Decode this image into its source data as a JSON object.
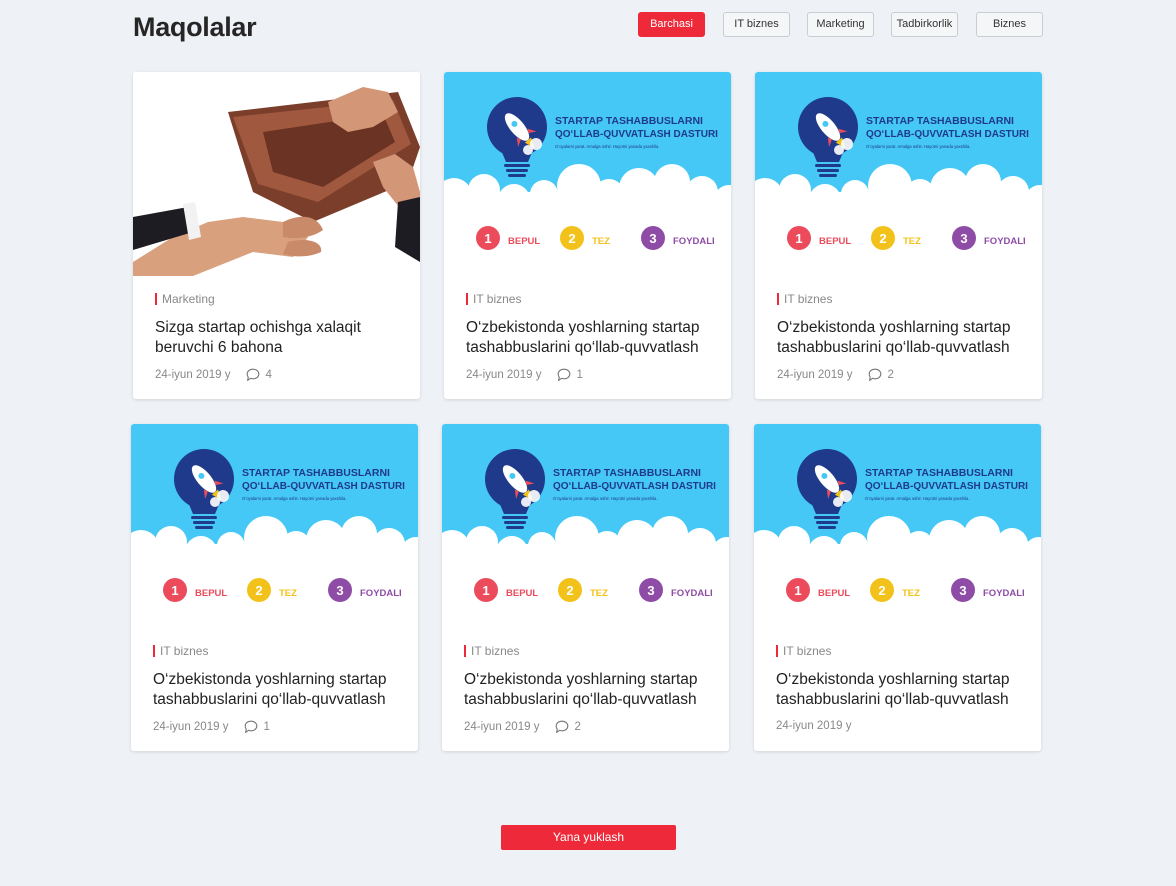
{
  "page": {
    "title": "Maqolalar"
  },
  "filters": [
    "Barchasi",
    "IT biznes",
    "Marketing",
    "Tadbirkorlik",
    "Biznes"
  ],
  "active_filter": "Barchasi",
  "banner": {
    "line1": "STARTAP  TASHABBUSLARNI",
    "line2": "QO‘LLAB-QUVVATLASH DASTURI",
    "tagline": "G‘oyalarni yarat. Amalga oshir. Hayotni yanada yaxshila.",
    "items": [
      {
        "num": "1",
        "label": "BEPUL"
      },
      {
        "num": "2",
        "label": "TEZ"
      },
      {
        "num": "3",
        "label": "FOYDALI"
      }
    ]
  },
  "articles": [
    {
      "image": "wallet-photo",
      "tag": "Marketing",
      "title": "Sizga startap ochishga xalaqit beruvchi 6 bahona",
      "date": "24-iyun 2019 y",
      "comments": "4"
    },
    {
      "image": "startup-banner",
      "tag": "IT biznes",
      "title": "O‘zbekistonda yoshlarning startap tashabbuslarini qo‘llab-quvvatlash",
      "date": "24-iyun 2019 y",
      "comments": "1"
    },
    {
      "image": "startup-banner",
      "tag": "IT biznes",
      "title": "O‘zbekistonda yoshlarning startap tashabbuslarini qo‘llab-quvvatlash",
      "date": "24-iyun 2019 y",
      "comments": "2"
    },
    {
      "image": "startup-banner",
      "tag": "IT biznes",
      "title": "O‘zbekistonda yoshlarning startap tashabbuslarini qo‘llab-quvvatlash",
      "date": "24-iyun 2019 y",
      "comments": "1"
    },
    {
      "image": "startup-banner",
      "tag": "IT biznes",
      "title": "O‘zbekistonda yoshlarning startap tashabbuslarini qo‘llab-quvvatlash",
      "date": "24-iyun 2019 y",
      "comments": "2"
    },
    {
      "image": "startup-banner",
      "tag": "IT biznes",
      "title": "O‘zbekistonda yoshlarning startap tashabbuslarini qo‘llab-quvvatlash",
      "date": "24-iyun 2019 y",
      "comments": null
    }
  ],
  "load_more_label": "Yana yuklash",
  "colors": {
    "accent": "#ee2a3a",
    "banner_sky": "#45c8f5",
    "banner_navy": "#1f3a8a",
    "num1": "#ec4b5c",
    "num2": "#f3c21a",
    "num3": "#8e4ca6"
  }
}
